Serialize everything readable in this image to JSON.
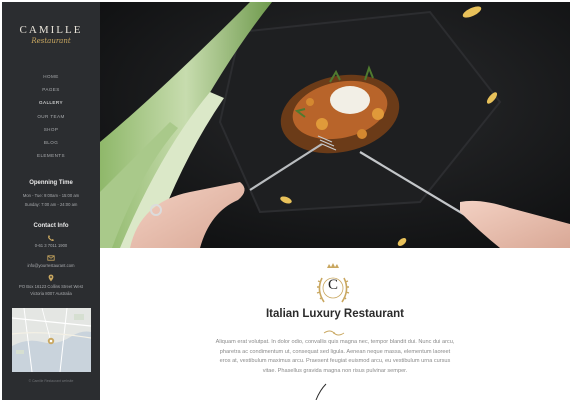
{
  "brand": {
    "name": "CAMILLE",
    "tagline": "Restaurant"
  },
  "nav": {
    "items": [
      {
        "label": "HOME"
      },
      {
        "label": "PAGES"
      },
      {
        "label": "GALLERY"
      },
      {
        "label": "OUR TEAM"
      },
      {
        "label": "SHOP"
      },
      {
        "label": "BLOG"
      },
      {
        "label": "ELEMENTS"
      }
    ],
    "active_index": 2
  },
  "opening": {
    "title": "Openning Time",
    "line1": "Mon - Tue: 9:00am - 15:00 am",
    "line2": "Sunday: 7:00 am - 24:00 am"
  },
  "contact": {
    "title": "Contact Info",
    "phone": "0-61 3 7011 1900",
    "email": "info@yourrestaurant.com",
    "address_line1": "PO Box 16123 Collins Street West",
    "address_line2": "Victoria 8007 Australia"
  },
  "footer": {
    "copyright": "© Camille Restaurant website"
  },
  "main": {
    "emblem_letter": "C",
    "title": "Italian Luxury Restaurant",
    "description": "Aliquam erat volutpat. In dolor odio, convallis quis magna nec, tempor blandit dui. Nunc dui arcu, pharetra ac condimentum ut, consequat sed ligula. Aenean neque massa, elementum laoreet eros at, vestibulum maximus arcu. Praesent feugiat euismod arcu, eu vestibulum urna cursus vitae. Phasellus gravida magna non risus pulvinar semper."
  },
  "colors": {
    "sidebar_bg": "#2b2d30",
    "accent_gold": "#c9a760",
    "hero_bg": "#121314"
  }
}
